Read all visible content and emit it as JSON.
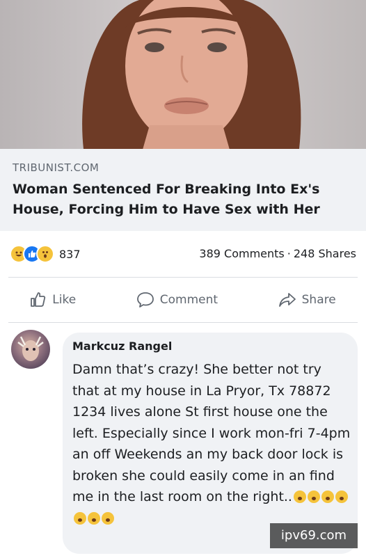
{
  "post": {
    "link_domain": "TRIBUNIST.COM",
    "link_headline": "Woman Sentenced For Breaking Into Ex's House, Forcing Him to Have Sex with Her"
  },
  "stats": {
    "reaction_icons": [
      "laugh-icon",
      "like-icon",
      "wow-icon"
    ],
    "reaction_colors": [
      "#f5c33b",
      "#1877f2",
      "#f5c33b"
    ],
    "reaction_count": "837",
    "comments": "389 Comments",
    "separator": "·",
    "shares": "248 Shares"
  },
  "actions": {
    "like": "Like",
    "comment": "Comment",
    "share": "Share"
  },
  "comment": {
    "author": "Markcuz Rangel",
    "text": "Damn that’s crazy! She better not try that at my house in La Pryor, Tx 78872 1234 lives alone St first house one the left. Especially since I work mon-fri 7-4pm an off Weekends an my back door lock is broken she could easily come in an find me in the last room on the right..",
    "emojis": [
      "wow-face-icon",
      "scream-face-icon",
      "squint-face-icon",
      "relieved-face-icon",
      "relieved-face-icon",
      "laughing-face-icon",
      "laughing-face-icon"
    ]
  },
  "watermark": "ipv69.com"
}
